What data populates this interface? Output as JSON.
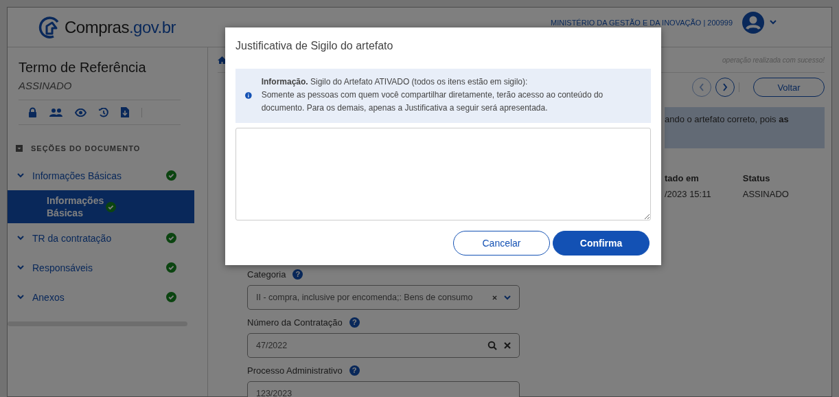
{
  "header": {
    "logo": {
      "name": "Compras",
      "domain": ".gov.br"
    },
    "org": "MINISTÉRIO DA GESTÃO E DA INOVAÇÃO | 200999"
  },
  "sidebar": {
    "title": "Termo de Referência",
    "status": "ASSINADO",
    "section_label": "SEÇÕES DO DOCUMENTO",
    "items": [
      {
        "label": "Informações Básicas",
        "done": true,
        "selected": false,
        "children": [
          {
            "label": "Informações Básicas",
            "done": true,
            "selected": true
          }
        ]
      },
      {
        "label": "TR da contratação",
        "done": true,
        "selected": false
      },
      {
        "label": "Responsáveis",
        "done": true,
        "selected": false
      },
      {
        "label": "Anexos",
        "done": true,
        "selected": false
      }
    ]
  },
  "main": {
    "notice": "operação realizada com sucesso!",
    "back_button": "Voltar",
    "alert": "ando o artefato correto, pois **as**",
    "meta": [
      {
        "header": "tado em",
        "value": "/2023 15:11"
      },
      {
        "header": "Status",
        "value": "ASSINADO"
      }
    ],
    "fields": [
      {
        "label": "Categoria",
        "help": "?",
        "kind": "select",
        "value": "II - compra, inclusive por encomenda;: Bens de consumo"
      },
      {
        "label": "Número da Contratação",
        "help": "?",
        "kind": "search",
        "value": "47/2022"
      },
      {
        "label": "Processo Administrativo",
        "help": "?",
        "kind": "text",
        "value": "123/2023"
      }
    ]
  },
  "modal": {
    "title": "Justificativa de Sigilo do artefato",
    "info": [
      "**Informação.** Sigilo do Artefato ATIVADO (todos os itens estão em sigilo):",
      "Somente as pessoas com quem você compartilhar diretamente, terão acesso ao conteúdo do documento. Para os demais, apenas a Justificativa a seguir será apresentada."
    ],
    "buttons": [
      {
        "label": "Cancelar",
        "kind": "secondary"
      },
      {
        "label": "Confirma",
        "kind": "primary"
      }
    ]
  }
}
